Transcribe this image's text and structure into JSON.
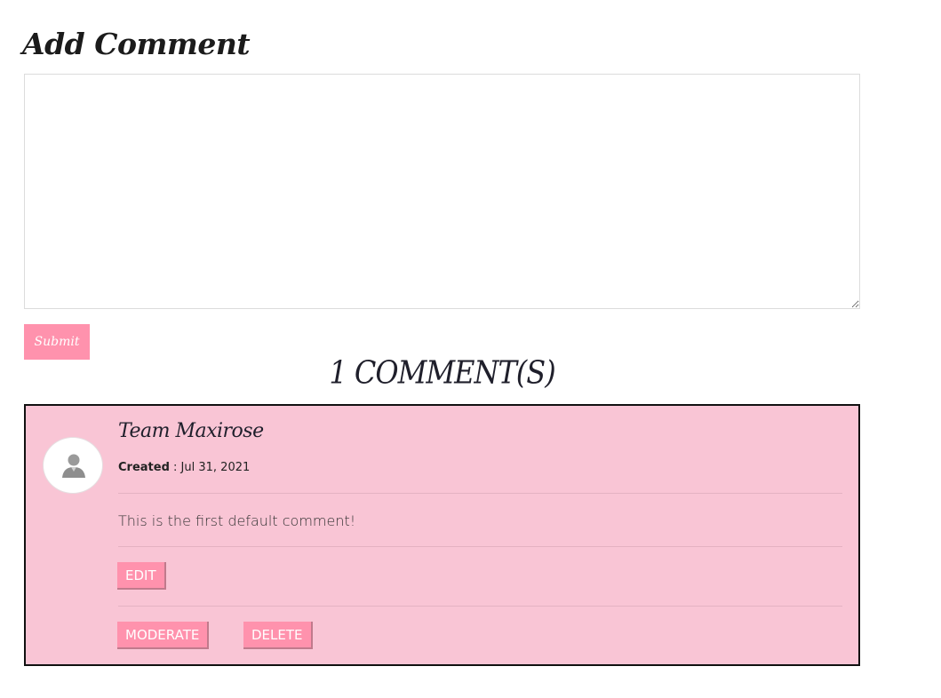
{
  "add_comment": {
    "title": "Add Comment",
    "textarea_value": "",
    "submit_label": "Submit"
  },
  "comments_count_title": "1 COMMENT(S)",
  "comment": {
    "author": "Team Maxirose",
    "created_label": "Created",
    "created_sep": " : ",
    "created_date": "Jul 31, 2021",
    "body": "This is the first default comment!",
    "edit_label": "EDIT",
    "moderate_label": "MODERATE",
    "delete_label": "DELETE",
    "avatar_icon": "user-avatar-icon"
  },
  "colors": {
    "accent_pink": "#ff92ad",
    "card_background": "#f9c5d5",
    "card_border": "#111111"
  }
}
